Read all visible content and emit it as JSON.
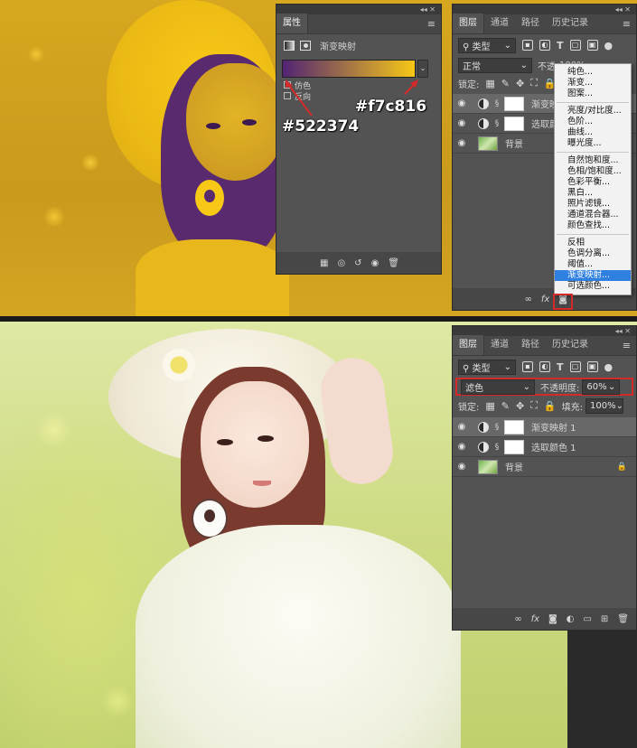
{
  "annotations": {
    "color_left": "#522374",
    "color_right": "#f7c816"
  },
  "colors": {
    "gradient_left": "#522374",
    "gradient_right": "#f7c816",
    "highlight": "#2f80e0",
    "annotation_red": "#d42a2a"
  },
  "properties_panel": {
    "tab": "属性",
    "title": "渐变映射",
    "dither_label": "仿色",
    "reverse_label": "反向"
  },
  "layers_top": {
    "tabs": [
      "图层",
      "通道",
      "路径",
      "历史记录"
    ],
    "kind_label": "类型",
    "blend_mode": "正常",
    "opacity_label": "不透",
    "opacity_value": "100%",
    "lock_label": "锁定:",
    "layers": [
      {
        "name": "渐变映"
      },
      {
        "name": "选取颜"
      },
      {
        "name": "背景"
      }
    ]
  },
  "adjust_menu": {
    "groups": [
      [
        "纯色...",
        "渐变...",
        "图案..."
      ],
      [
        "亮度/对比度...",
        "色阶...",
        "曲线...",
        "曝光度..."
      ],
      [
        "自然饱和度...",
        "色相/饱和度...",
        "色彩平衡...",
        "黑白...",
        "照片滤镜...",
        "通道混合器...",
        "颜色查找..."
      ],
      [
        "反相",
        "色调分离...",
        "阈值...",
        "渐变映射...",
        "可选颜色..."
      ]
    ],
    "highlighted": "渐变映射..."
  },
  "layers_bottom": {
    "tabs": [
      "图层",
      "通道",
      "路径",
      "历史记录"
    ],
    "kind_label": "类型",
    "blend_mode": "滤色",
    "opacity_label": "不透明度:",
    "opacity_value": "60%",
    "lock_label": "锁定:",
    "fill_label": "填充:",
    "fill_value": "100%",
    "layers": [
      {
        "name": "渐变映射 1"
      },
      {
        "name": "选取颜色 1"
      },
      {
        "name": "背景"
      }
    ]
  }
}
